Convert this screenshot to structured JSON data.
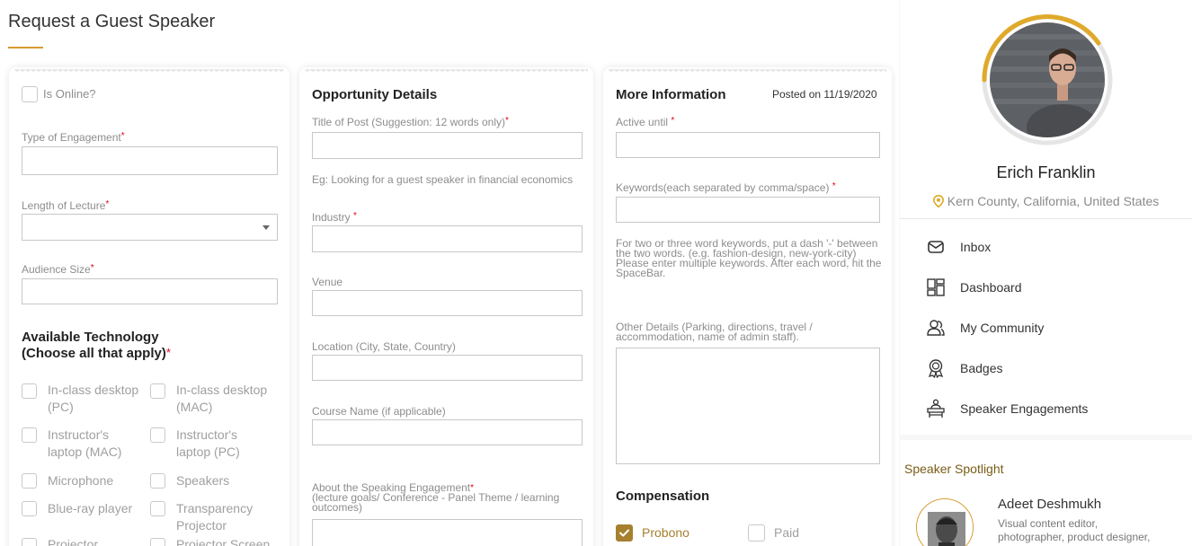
{
  "page": {
    "title": "Request a Guest Speaker"
  },
  "card1": {
    "is_online": "Is Online?",
    "type_of_engagement": "Type of Engagement",
    "length_of_lecture": "Length of Lecture",
    "audience_size": "Audience Size",
    "tech_heading_line1": "Available Technology",
    "tech_heading_line2": "(Choose all that apply)",
    "tech": [
      {
        "line1": "In-class desktop",
        "line2": "(PC)"
      },
      {
        "line1": "In-class desktop",
        "line2": "(MAC)"
      },
      {
        "line1": "Instructor's",
        "line2": "laptop (MAC)"
      },
      {
        "line1": "Instructor's",
        "line2": "laptop (PC)"
      },
      {
        "line1": "Microphone",
        "line2": ""
      },
      {
        "line1": "Speakers",
        "line2": ""
      },
      {
        "line1": "Blue-ray player",
        "line2": ""
      },
      {
        "line1": "Transparency",
        "line2": "Projector"
      },
      {
        "line1": "Projector",
        "line2": ""
      },
      {
        "line1": "Projector Screen",
        "line2": ""
      }
    ]
  },
  "card2": {
    "heading": "Opportunity Details",
    "title_of_post": "Title of Post (Suggestion: 12 words only)",
    "title_hint": "Eg: Looking for a guest speaker in financial economics",
    "industry": "Industry",
    "venue": "Venue",
    "location": "Location (City, State, Country)",
    "course_name": "Course Name (if applicable)",
    "about_line1": "About the Speaking Engagement",
    "about_line2": "(lecture goals/ Conference - Panel Theme / learning",
    "about_line3": "outcomes)"
  },
  "card3": {
    "heading": "More Information",
    "posted_on": "Posted on 11/19/2020",
    "active_until": "Active until",
    "keywords": "Keywords(each separated by comma/space)",
    "keywords_hint_1": "For two or three word keywords, put a dash '-' between",
    "keywords_hint_2": "the two words. (e.g. fashion-design, new-york-city)",
    "keywords_hint_3": "Please enter multiple keywords. After each word, hit the",
    "keywords_hint_4": "SpaceBar.",
    "other_details_1": "Other Details (Parking, directions, travel /",
    "other_details_2": "accommodation, name of admin staff).",
    "compensation": "Compensation",
    "probono": "Probono",
    "paid": "Paid",
    "probono_checked": true
  },
  "profile": {
    "name": "Erich Franklin",
    "location": "Kern County, California, United States",
    "nav": [
      {
        "label": "Inbox",
        "icon": "envelope-icon"
      },
      {
        "label": "Dashboard",
        "icon": "dashboard-icon"
      },
      {
        "label": "My Community",
        "icon": "community-icon"
      },
      {
        "label": "Badges",
        "icon": "badge-icon"
      },
      {
        "label": "Speaker Engagements",
        "icon": "podium-icon"
      }
    ]
  },
  "spotlight": {
    "title": "Speaker Spotlight",
    "name": "Adeet Deshmukh",
    "desc_line1": "Visual content editor,",
    "desc_line2": "photographer, product designer,"
  },
  "colors": {
    "accent": "#d69a2f",
    "required": "#e0001b",
    "checkbox_checked": "#a6802f"
  }
}
